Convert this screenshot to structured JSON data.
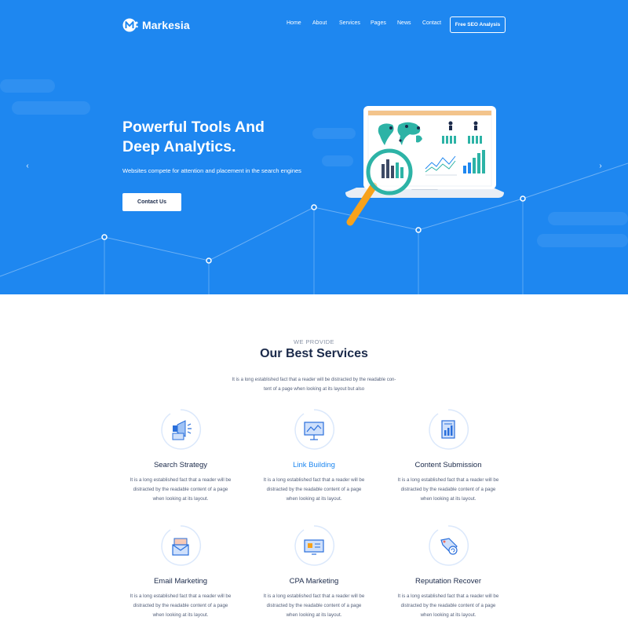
{
  "nav": {
    "brand": "Markesia",
    "items": [
      {
        "label": "Home"
      },
      {
        "label": "About"
      },
      {
        "label": "Services"
      },
      {
        "label": "Pages"
      },
      {
        "label": "News"
      },
      {
        "label": "Contact"
      }
    ],
    "cta": "Free SEO Analysis"
  },
  "hero": {
    "title_line1": "Powerful Tools And",
    "title_line2": "Deep Analytics.",
    "subtitle": "Websites compete for attention and placement in the search engines",
    "button": "Contact Us",
    "prev_arrow": "‹",
    "next_arrow": "›"
  },
  "services": {
    "eyebrow": "WE PROVIDE",
    "title": "Our Best Services",
    "desc_line1": "It is a long established fact that a reader will be distracted by the readable con-",
    "desc_line2": "tent of a page when looking at its layout  but also",
    "items": [
      {
        "title": "Search Strategy",
        "icon": "megaphone-icon",
        "line1": "It is a long established fact that a reader will be",
        "line2": "distracted by the readable content of a page",
        "line3": "when looking at its layout."
      },
      {
        "title": "Link Building",
        "icon": "presentation-board-icon",
        "line1": "It is a long established fact that a reader will be",
        "line2": "distracted by the readable content of a page",
        "line3": "when looking at its layout."
      },
      {
        "title": "Content Submission",
        "icon": "document-chart-icon",
        "line1": "It is a long established fact that a reader will be",
        "line2": "distracted by the readable content of a page",
        "line3": "when looking at its layout."
      },
      {
        "title": "Email Marketing",
        "icon": "envelope-icon",
        "line1": "It is a long established fact that a reader will be",
        "line2": "distracted by the readable content of a page",
        "line3": "when looking at its layout."
      },
      {
        "title": "CPA Marketing",
        "icon": "monitor-icon",
        "line1": "It is a long established fact that a reader will be",
        "line2": "distracted by the readable content of a page",
        "line3": "when looking at its layout."
      },
      {
        "title": "Reputation Recover",
        "icon": "tag-refresh-icon",
        "line1": "It is a long established fact that a reader will be",
        "line2": "distracted by the readable content of a page",
        "line3": "when looking at its layout."
      }
    ]
  },
  "colors": {
    "hero_bg": "#1e87f0",
    "accent": "#1e87f0",
    "heading": "#1b2a4a",
    "body_text": "#54607a",
    "teal": "#2db3a6",
    "orange": "#f7a21b"
  }
}
